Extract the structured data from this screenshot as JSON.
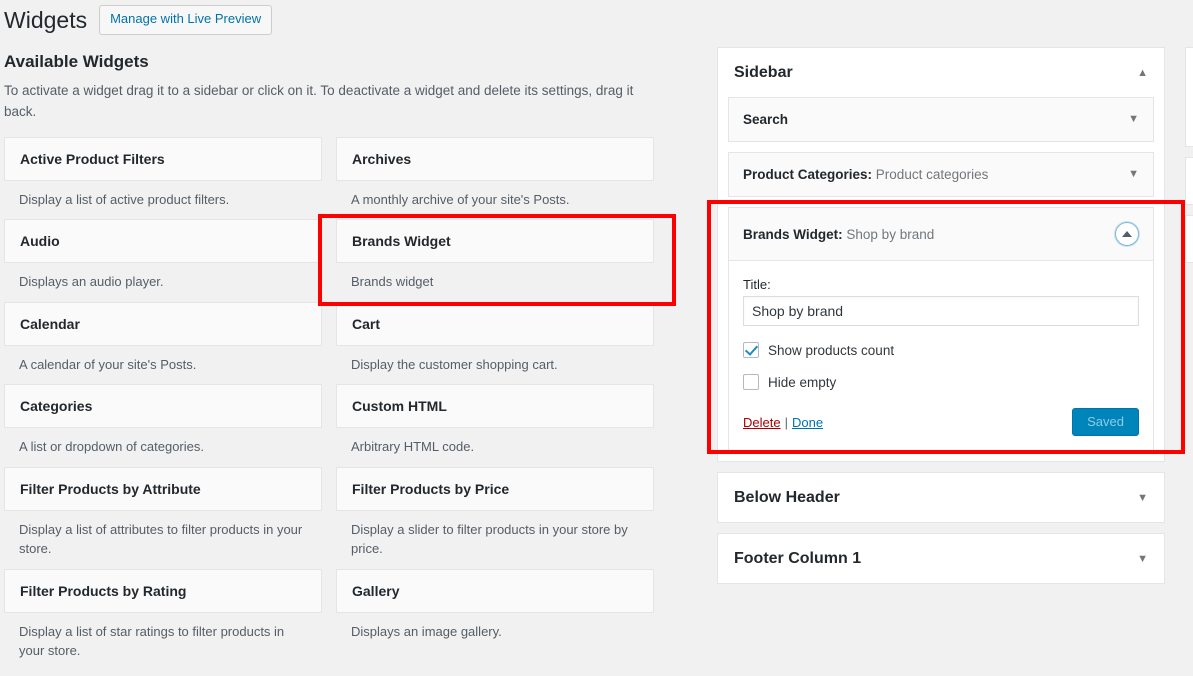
{
  "header": {
    "title": "Widgets",
    "live_preview_label": "Manage with Live Preview"
  },
  "available": {
    "heading": "Available Widgets",
    "description": "To activate a widget drag it to a sidebar or click on it. To deactivate a widget and delete its settings, drag it back.",
    "column_left": [
      {
        "name": "Active Product Filters",
        "desc": "Display a list of active product filters."
      },
      {
        "name": "Audio",
        "desc": "Displays an audio player."
      },
      {
        "name": "Calendar",
        "desc": "A calendar of your site's Posts."
      },
      {
        "name": "Categories",
        "desc": "A list or dropdown of categories."
      },
      {
        "name": "Filter Products by Attribute",
        "desc": "Display a list of attributes to filter products in your store."
      },
      {
        "name": "Filter Products by Rating",
        "desc": "Display a list of star ratings to filter products in your store."
      }
    ],
    "column_right": [
      {
        "name": "Archives",
        "desc": "A monthly archive of your site's Posts."
      },
      {
        "name": "Brands Widget",
        "desc": "Brands widget"
      },
      {
        "name": "Cart",
        "desc": "Display the customer shopping cart."
      },
      {
        "name": "Custom HTML",
        "desc": "Arbitrary HTML code."
      },
      {
        "name": "Filter Products by Price",
        "desc": "Display a slider to filter products in your store by price."
      },
      {
        "name": "Gallery",
        "desc": "Displays an image gallery."
      }
    ]
  },
  "sidebars": {
    "sidebar": {
      "title": "Sidebar",
      "toggle_icon": "▲",
      "widgets": [
        {
          "title": "Search",
          "instance": "",
          "toggle_icon": "▼"
        },
        {
          "title": "Product Categories:",
          "instance": "Product categories",
          "toggle_icon": "▼"
        }
      ],
      "open_widget": {
        "title": "Brands Widget:",
        "instance": "Shop by brand",
        "toggle_icon": "▲",
        "form": {
          "title_label": "Title:",
          "title_value": "Shop by brand",
          "title_placeholder": "",
          "checkbox_show_count_label": "Show products count",
          "checkbox_show_count_checked": true,
          "checkbox_hide_empty_label": "Hide empty",
          "checkbox_hide_empty_checked": false,
          "delete_label": "Delete",
          "separator": "|",
          "done_label": "Done",
          "save_label": "Saved"
        }
      }
    },
    "below_header": {
      "title": "Below Header",
      "toggle_icon": "▼"
    },
    "footer_column_1": {
      "title": "Footer Column 1",
      "toggle_icon": "▼"
    }
  },
  "annotations": {
    "highlight_color": "#fe0000",
    "boxes": [
      {
        "name": "available-brands-widget-highlight"
      },
      {
        "name": "sidebar-brands-widget-highlight"
      }
    ]
  }
}
